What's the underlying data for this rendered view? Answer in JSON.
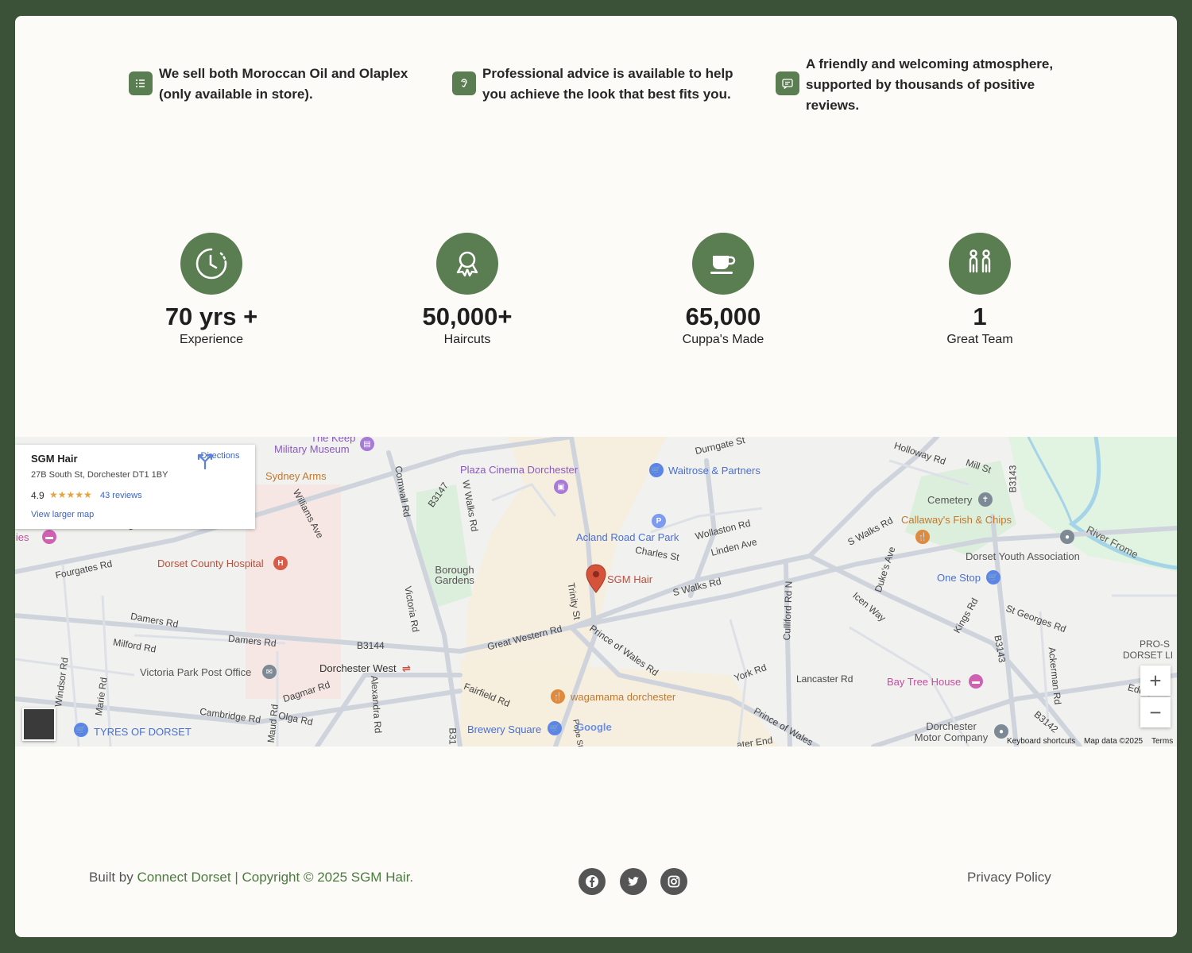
{
  "features": [
    {
      "icon": "list-icon",
      "text": "We sell both Moroccan Oil and Olaplex (only available in store)."
    },
    {
      "icon": "ear-icon",
      "text": "Professional advice is available to help you achieve the look that best fits you."
    },
    {
      "icon": "review-icon",
      "text": "A friendly and welcoming atmosphere, supported by thousands of positive reviews."
    }
  ],
  "stats": [
    {
      "icon": "clock-icon",
      "number": "70 yrs +",
      "label": "Experience"
    },
    {
      "icon": "award-icon",
      "number": "50,000+",
      "label": "Haircuts"
    },
    {
      "icon": "coffee-cup-icon",
      "number": "65,000",
      "label": "Cuppa's Made"
    },
    {
      "icon": "team-icon",
      "number": "1",
      "label": "Great Team"
    }
  ],
  "map": {
    "card": {
      "name": "SGM Hair",
      "address": "27B South St, Dorchester DT1 1BY",
      "rating": "4.9",
      "stars": "★★★★★",
      "reviews": "43 reviews",
      "directions": "Directions",
      "larger_map": "View larger map"
    },
    "marker_label": "SGM Hair",
    "pois": {
      "keep": "The Keep",
      "military": "Military Museum",
      "durngate": "Durngate St",
      "holloway": "Holloway Rd",
      "mill": "Mill St",
      "b3143_top": "B3143",
      "sydney": "Sydney Arms",
      "plaza": "Plaza Cinema Dorchester",
      "waitrose": "Waitrose & Partners",
      "cemetery": "Cemetery",
      "callaways": "Callaway's Fish & Chips",
      "river": "River Frome",
      "cornwall": "Cornwall Rd",
      "b3147": "B3147",
      "wwalks": "W Walks Rd",
      "williams": "Williams Ave",
      "acland": "Acland Road Car Park",
      "wollaston": "Wollaston Rd",
      "charles": "Charles St",
      "linden": "Linden Ave",
      "swalks_top": "S Walks Rd",
      "youth": "Dorset Youth Association",
      "lies": "lies",
      "brid": "Brid",
      "fourgates": "Fourgates Rd",
      "hospital": "Dorset County Hospital",
      "borough": "Borough Gardens",
      "victoria_rd": "Victoria Rd",
      "trinity": "Trinity St",
      "swalks": "S Walks Rd",
      "icen": "Icen Way",
      "dukes": "Duke's Ave",
      "onestop": "One Stop",
      "kings": "Kings Rd",
      "stgeorges": "St Georges Rd",
      "culliford": "Culliford Rd N",
      "damers1": "Damers Rd",
      "damers2": "Damers Rd",
      "milford": "Milford Rd",
      "b3144": "B3144",
      "greatwestern": "Great Western Rd",
      "prince": "Prince of Wales Rd",
      "pro": "PRO-S",
      "dorsetli": "DORSET LI",
      "victoria_po": "Victoria Park Post Office",
      "dorchester_west": "Dorchester West",
      "yorkrd": "York Rd",
      "lancaster": "Lancaster Rd",
      "baytree": "Bay Tree House",
      "b3143_right": "B3143",
      "ackerman": "Ackerman Rd",
      "eddis": "Eddis",
      "windsor": "Windsor Rd",
      "marie": "Marie Rd",
      "dagmar": "Dagmar Rd",
      "alexandra": "Alexandra Rd",
      "fairfield": "Fairfield Rd",
      "wagamama": "wagamama dorchester",
      "prince2": "Prince of Wales",
      "cambridge": "Cambridge Rd",
      "olga": "Olga Rd",
      "maud": "Maud Rd",
      "tyres": "TYRES OF DORSET",
      "brewery": "Brewery Square",
      "b31": "B31",
      "pope": "Pope St",
      "motor": "Dorchester Motor Company",
      "waterend": "ater End",
      "b3142": "B3142"
    },
    "attribution": {
      "google": "Google",
      "keyboard": "Keyboard shortcuts",
      "mapdata": "Map data ©2025",
      "terms": "Terms"
    },
    "zoom_in": "+",
    "zoom_out": "−"
  },
  "footer": {
    "built_by": "Built by",
    "connect": "Connect Dorset",
    "copyright": " | Copyright © 2025 SGM Hair.",
    "privacy": "Privacy Policy",
    "social": [
      "facebook-icon",
      "twitter-icon",
      "instagram-icon"
    ]
  },
  "colors": {
    "brand_green": "#5a7e52",
    "page_bg": "#3b5238",
    "card_bg": "#fcfbf8"
  }
}
